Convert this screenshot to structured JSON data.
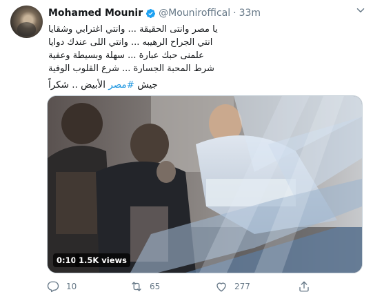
{
  "author": {
    "name": "Mohamed Mounir",
    "handle": "@Mouniroffical",
    "time": "33m"
  },
  "tweet": {
    "lines": [
      "يا مصر وانتى الحقيقة ... وانتي اغترابي وشقايا",
      "انتي الجراح الرهيبه ... وانتي اللى عندك دوايا",
      "علمنى حبك عبارة ... سهلة وبسيطة وعفية",
      "شرط المحبة الجسارة ... شرع القلوب الوفية"
    ],
    "closing_prefix": "جيش ",
    "hashtag": "#مصر",
    "closing_suffix": " الأبيض .. شكراً"
  },
  "media": {
    "duration": "0:10",
    "views": "1.5K views"
  },
  "actions": {
    "replies": "10",
    "retweets": "65",
    "likes": "277"
  },
  "colors": {
    "link": "#1b95e0",
    "secondary_text": "#657786",
    "verified": "#1da1f2"
  },
  "icons": {
    "verified": "verified-badge-icon",
    "caret": "chevron-down-icon",
    "reply": "reply-icon",
    "retweet": "retweet-icon",
    "like": "heart-icon",
    "share": "share-icon"
  }
}
